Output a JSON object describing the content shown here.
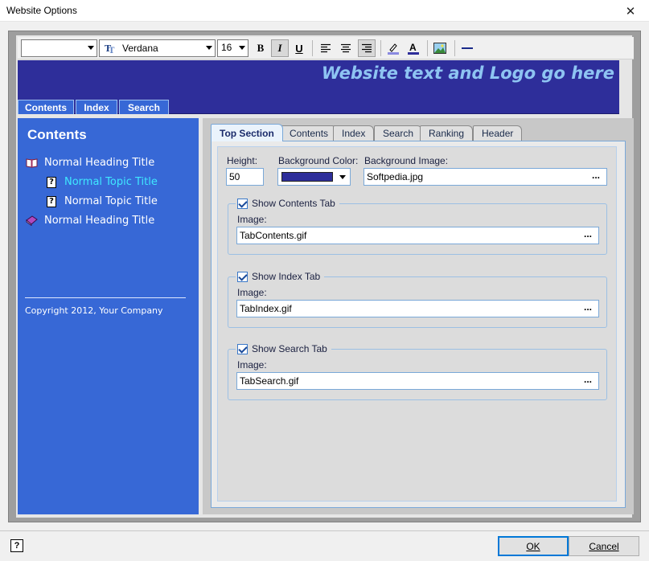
{
  "window": {
    "title": "Website Options",
    "close_glyph": "✕"
  },
  "toolbar": {
    "style_combo_value": "",
    "font_combo_value": "Verdana",
    "font_icon": "truetype-font-icon",
    "size_combo_value": "16",
    "bold": "B",
    "italic": "I",
    "underline": "U"
  },
  "banner": {
    "text": "Website text and Logo go here",
    "background": "#2e2e9a",
    "text_color": "#8ec4f2",
    "tabs": [
      {
        "label": "Contents"
      },
      {
        "label": "Index"
      },
      {
        "label": "Search"
      }
    ]
  },
  "sidebar": {
    "title": "Contents",
    "background": "#3768d6",
    "items": [
      {
        "label": "Normal Heading Title",
        "icon": "open-book-icon"
      },
      {
        "label": "Normal Topic Title",
        "icon": "help-topic-icon",
        "selected": true
      },
      {
        "label": "Normal Topic Title",
        "icon": "help-topic-icon"
      },
      {
        "label": "Normal Heading Title",
        "icon": "closed-book-icon"
      }
    ],
    "copyright": "Copyright 2012, Your Company"
  },
  "tabs": [
    {
      "label": "Top Section",
      "active": true
    },
    {
      "label": "Contents"
    },
    {
      "label": "Index"
    },
    {
      "label": "Search"
    },
    {
      "label": "Ranking"
    },
    {
      "label": "Header"
    }
  ],
  "top_section": {
    "height_label": "Height:",
    "height_value": "50",
    "bg_color_label": "Background Color:",
    "bg_color_value": "#2e2e9a",
    "bg_image_label": "Background Image:",
    "bg_image_value": "Softpedia.jpg",
    "browse_glyph": "...",
    "groups": [
      {
        "checkbox_label": "Show Contents Tab",
        "checked": true,
        "image_label": "Image:",
        "image_value": "TabContents.gif"
      },
      {
        "checkbox_label": "Show Index Tab",
        "checked": true,
        "image_label": "Image:",
        "image_value": "TabIndex.gif"
      },
      {
        "checkbox_label": "Show Search Tab",
        "checked": true,
        "image_label": "Image:",
        "image_value": "TabSearch.gif"
      }
    ]
  },
  "footer": {
    "help_glyph": "?",
    "ok_label": "OK",
    "cancel_label": "Cancel"
  }
}
